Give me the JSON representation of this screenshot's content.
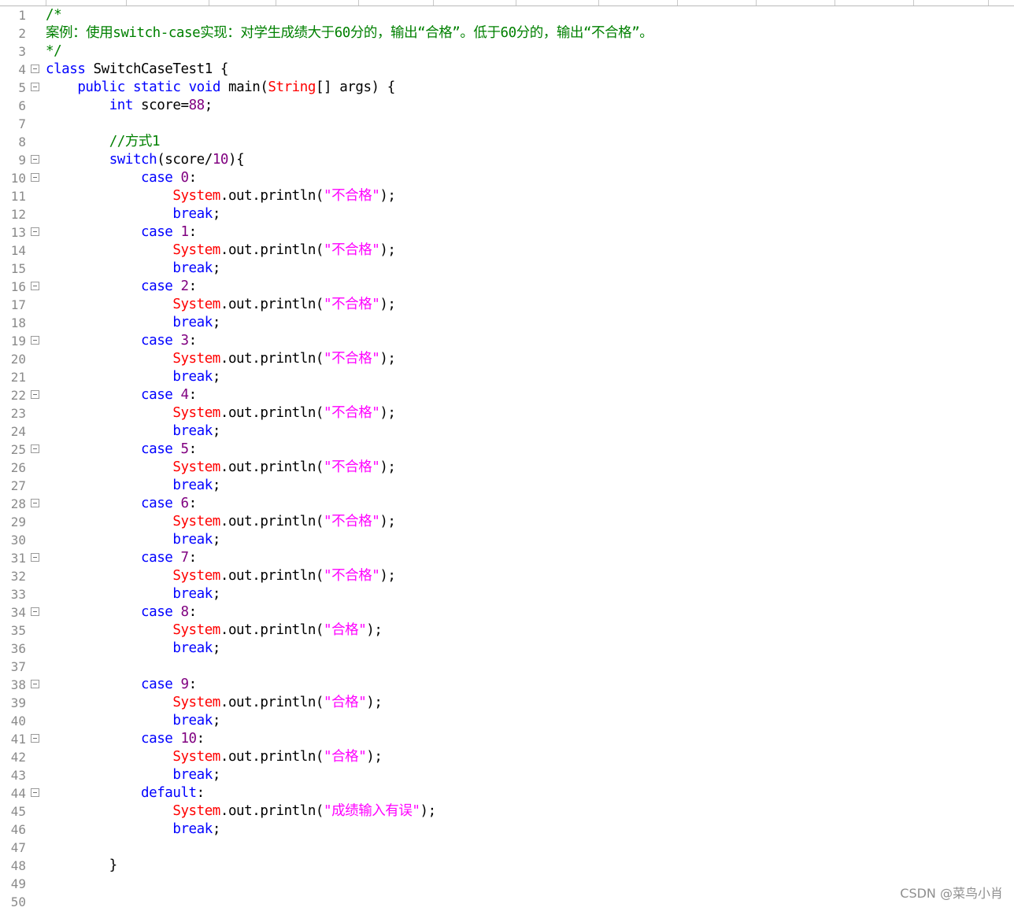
{
  "editor": {
    "lines": [
      {
        "n": "1",
        "fold": false,
        "tokens": [
          {
            "t": "/*",
            "c": "cmt"
          }
        ]
      },
      {
        "n": "2",
        "fold": false,
        "tokens": [
          {
            "t": "案例：使用switch-case实现：对学生成绩大于60分的，输出“合格”。低于60分的，输出“不合格”。",
            "c": "cmt"
          }
        ]
      },
      {
        "n": "3",
        "fold": false,
        "tokens": [
          {
            "t": "*/",
            "c": "cmt"
          }
        ]
      },
      {
        "n": "4",
        "fold": true,
        "tokens": [
          {
            "t": "class",
            "c": "kw"
          },
          {
            "t": " SwitchCaseTest1 {",
            "c": "plain"
          }
        ]
      },
      {
        "n": "5",
        "fold": true,
        "tokens": [
          {
            "t": "    ",
            "c": "plain"
          },
          {
            "t": "public",
            "c": "kw"
          },
          {
            "t": " ",
            "c": "plain"
          },
          {
            "t": "static",
            "c": "kw"
          },
          {
            "t": " ",
            "c": "plain"
          },
          {
            "t": "void",
            "c": "kw"
          },
          {
            "t": " main(",
            "c": "plain"
          },
          {
            "t": "String",
            "c": "type"
          },
          {
            "t": "[] args) {",
            "c": "plain"
          }
        ]
      },
      {
        "n": "6",
        "fold": false,
        "tokens": [
          {
            "t": "        ",
            "c": "plain"
          },
          {
            "t": "int",
            "c": "kw"
          },
          {
            "t": " score=",
            "c": "plain"
          },
          {
            "t": "88",
            "c": "num"
          },
          {
            "t": ";",
            "c": "plain"
          }
        ]
      },
      {
        "n": "7",
        "fold": false,
        "tokens": []
      },
      {
        "n": "8",
        "fold": false,
        "tokens": [
          {
            "t": "        ",
            "c": "plain"
          },
          {
            "t": "//方式1",
            "c": "cmt"
          }
        ]
      },
      {
        "n": "9",
        "fold": true,
        "tokens": [
          {
            "t": "        ",
            "c": "plain"
          },
          {
            "t": "switch",
            "c": "kw"
          },
          {
            "t": "(score/",
            "c": "plain"
          },
          {
            "t": "10",
            "c": "num"
          },
          {
            "t": "){",
            "c": "plain"
          }
        ]
      },
      {
        "n": "10",
        "fold": true,
        "tokens": [
          {
            "t": "            ",
            "c": "plain"
          },
          {
            "t": "case",
            "c": "kw"
          },
          {
            "t": " ",
            "c": "plain"
          },
          {
            "t": "0",
            "c": "num"
          },
          {
            "t": ":",
            "c": "plain"
          }
        ]
      },
      {
        "n": "11",
        "fold": false,
        "tokens": [
          {
            "t": "                ",
            "c": "plain"
          },
          {
            "t": "System",
            "c": "type"
          },
          {
            "t": ".out.println(",
            "c": "plain"
          },
          {
            "t": "\"不合格\"",
            "c": "str"
          },
          {
            "t": ");",
            "c": "plain"
          }
        ]
      },
      {
        "n": "12",
        "fold": false,
        "tokens": [
          {
            "t": "                ",
            "c": "plain"
          },
          {
            "t": "break",
            "c": "kw"
          },
          {
            "t": ";",
            "c": "plain"
          }
        ]
      },
      {
        "n": "13",
        "fold": true,
        "tokens": [
          {
            "t": "            ",
            "c": "plain"
          },
          {
            "t": "case",
            "c": "kw"
          },
          {
            "t": " ",
            "c": "plain"
          },
          {
            "t": "1",
            "c": "num"
          },
          {
            "t": ":",
            "c": "plain"
          }
        ]
      },
      {
        "n": "14",
        "fold": false,
        "tokens": [
          {
            "t": "                ",
            "c": "plain"
          },
          {
            "t": "System",
            "c": "type"
          },
          {
            "t": ".out.println(",
            "c": "plain"
          },
          {
            "t": "\"不合格\"",
            "c": "str"
          },
          {
            "t": ");",
            "c": "plain"
          }
        ]
      },
      {
        "n": "15",
        "fold": false,
        "tokens": [
          {
            "t": "                ",
            "c": "plain"
          },
          {
            "t": "break",
            "c": "kw"
          },
          {
            "t": ";",
            "c": "plain"
          }
        ]
      },
      {
        "n": "16",
        "fold": true,
        "tokens": [
          {
            "t": "            ",
            "c": "plain"
          },
          {
            "t": "case",
            "c": "kw"
          },
          {
            "t": " ",
            "c": "plain"
          },
          {
            "t": "2",
            "c": "num"
          },
          {
            "t": ":",
            "c": "plain"
          }
        ]
      },
      {
        "n": "17",
        "fold": false,
        "tokens": [
          {
            "t": "                ",
            "c": "plain"
          },
          {
            "t": "System",
            "c": "type"
          },
          {
            "t": ".out.println(",
            "c": "plain"
          },
          {
            "t": "\"不合格\"",
            "c": "str"
          },
          {
            "t": ");",
            "c": "plain"
          }
        ]
      },
      {
        "n": "18",
        "fold": false,
        "tokens": [
          {
            "t": "                ",
            "c": "plain"
          },
          {
            "t": "break",
            "c": "kw"
          },
          {
            "t": ";",
            "c": "plain"
          }
        ]
      },
      {
        "n": "19",
        "fold": true,
        "tokens": [
          {
            "t": "            ",
            "c": "plain"
          },
          {
            "t": "case",
            "c": "kw"
          },
          {
            "t": " ",
            "c": "plain"
          },
          {
            "t": "3",
            "c": "num"
          },
          {
            "t": ":",
            "c": "plain"
          }
        ]
      },
      {
        "n": "20",
        "fold": false,
        "tokens": [
          {
            "t": "                ",
            "c": "plain"
          },
          {
            "t": "System",
            "c": "type"
          },
          {
            "t": ".out.println(",
            "c": "plain"
          },
          {
            "t": "\"不合格\"",
            "c": "str"
          },
          {
            "t": ");",
            "c": "plain"
          }
        ]
      },
      {
        "n": "21",
        "fold": false,
        "tokens": [
          {
            "t": "                ",
            "c": "plain"
          },
          {
            "t": "break",
            "c": "kw"
          },
          {
            "t": ";",
            "c": "plain"
          }
        ]
      },
      {
        "n": "22",
        "fold": true,
        "tokens": [
          {
            "t": "            ",
            "c": "plain"
          },
          {
            "t": "case",
            "c": "kw"
          },
          {
            "t": " ",
            "c": "plain"
          },
          {
            "t": "4",
            "c": "num"
          },
          {
            "t": ":",
            "c": "plain"
          }
        ]
      },
      {
        "n": "23",
        "fold": false,
        "tokens": [
          {
            "t": "                ",
            "c": "plain"
          },
          {
            "t": "System",
            "c": "type"
          },
          {
            "t": ".out.println(",
            "c": "plain"
          },
          {
            "t": "\"不合格\"",
            "c": "str"
          },
          {
            "t": ");",
            "c": "plain"
          }
        ]
      },
      {
        "n": "24",
        "fold": false,
        "tokens": [
          {
            "t": "                ",
            "c": "plain"
          },
          {
            "t": "break",
            "c": "kw"
          },
          {
            "t": ";",
            "c": "plain"
          }
        ]
      },
      {
        "n": "25",
        "fold": true,
        "tokens": [
          {
            "t": "            ",
            "c": "plain"
          },
          {
            "t": "case",
            "c": "kw"
          },
          {
            "t": " ",
            "c": "plain"
          },
          {
            "t": "5",
            "c": "num"
          },
          {
            "t": ":",
            "c": "plain"
          }
        ]
      },
      {
        "n": "26",
        "fold": false,
        "tokens": [
          {
            "t": "                ",
            "c": "plain"
          },
          {
            "t": "System",
            "c": "type"
          },
          {
            "t": ".out.println(",
            "c": "plain"
          },
          {
            "t": "\"不合格\"",
            "c": "str"
          },
          {
            "t": ");",
            "c": "plain"
          }
        ]
      },
      {
        "n": "27",
        "fold": false,
        "tokens": [
          {
            "t": "                ",
            "c": "plain"
          },
          {
            "t": "break",
            "c": "kw"
          },
          {
            "t": ";",
            "c": "plain"
          }
        ]
      },
      {
        "n": "28",
        "fold": true,
        "tokens": [
          {
            "t": "            ",
            "c": "plain"
          },
          {
            "t": "case",
            "c": "kw"
          },
          {
            "t": " ",
            "c": "plain"
          },
          {
            "t": "6",
            "c": "num"
          },
          {
            "t": ":",
            "c": "plain"
          }
        ]
      },
      {
        "n": "29",
        "fold": false,
        "tokens": [
          {
            "t": "                ",
            "c": "plain"
          },
          {
            "t": "System",
            "c": "type"
          },
          {
            "t": ".out.println(",
            "c": "plain"
          },
          {
            "t": "\"不合格\"",
            "c": "str"
          },
          {
            "t": ");",
            "c": "plain"
          }
        ]
      },
      {
        "n": "30",
        "fold": false,
        "tokens": [
          {
            "t": "                ",
            "c": "plain"
          },
          {
            "t": "break",
            "c": "kw"
          },
          {
            "t": ";",
            "c": "plain"
          }
        ]
      },
      {
        "n": "31",
        "fold": true,
        "tokens": [
          {
            "t": "            ",
            "c": "plain"
          },
          {
            "t": "case",
            "c": "kw"
          },
          {
            "t": " ",
            "c": "plain"
          },
          {
            "t": "7",
            "c": "num"
          },
          {
            "t": ":",
            "c": "plain"
          }
        ]
      },
      {
        "n": "32",
        "fold": false,
        "tokens": [
          {
            "t": "                ",
            "c": "plain"
          },
          {
            "t": "System",
            "c": "type"
          },
          {
            "t": ".out.println(",
            "c": "plain"
          },
          {
            "t": "\"不合格\"",
            "c": "str"
          },
          {
            "t": ");",
            "c": "plain"
          }
        ]
      },
      {
        "n": "33",
        "fold": false,
        "tokens": [
          {
            "t": "                ",
            "c": "plain"
          },
          {
            "t": "break",
            "c": "kw"
          },
          {
            "t": ";",
            "c": "plain"
          }
        ]
      },
      {
        "n": "34",
        "fold": true,
        "tokens": [
          {
            "t": "            ",
            "c": "plain"
          },
          {
            "t": "case",
            "c": "kw"
          },
          {
            "t": " ",
            "c": "plain"
          },
          {
            "t": "8",
            "c": "num"
          },
          {
            "t": ":",
            "c": "plain"
          }
        ]
      },
      {
        "n": "35",
        "fold": false,
        "tokens": [
          {
            "t": "                ",
            "c": "plain"
          },
          {
            "t": "System",
            "c": "type"
          },
          {
            "t": ".out.println(",
            "c": "plain"
          },
          {
            "t": "\"合格\"",
            "c": "str"
          },
          {
            "t": ");",
            "c": "plain"
          }
        ]
      },
      {
        "n": "36",
        "fold": false,
        "tokens": [
          {
            "t": "                ",
            "c": "plain"
          },
          {
            "t": "break",
            "c": "kw"
          },
          {
            "t": ";",
            "c": "plain"
          }
        ]
      },
      {
        "n": "37",
        "fold": false,
        "tokens": []
      },
      {
        "n": "38",
        "fold": true,
        "tokens": [
          {
            "t": "            ",
            "c": "plain"
          },
          {
            "t": "case",
            "c": "kw"
          },
          {
            "t": " ",
            "c": "plain"
          },
          {
            "t": "9",
            "c": "num"
          },
          {
            "t": ":",
            "c": "plain"
          }
        ]
      },
      {
        "n": "39",
        "fold": false,
        "tokens": [
          {
            "t": "                ",
            "c": "plain"
          },
          {
            "t": "System",
            "c": "type"
          },
          {
            "t": ".out.println(",
            "c": "plain"
          },
          {
            "t": "\"合格\"",
            "c": "str"
          },
          {
            "t": ");",
            "c": "plain"
          }
        ]
      },
      {
        "n": "40",
        "fold": false,
        "tokens": [
          {
            "t": "                ",
            "c": "plain"
          },
          {
            "t": "break",
            "c": "kw"
          },
          {
            "t": ";",
            "c": "plain"
          }
        ]
      },
      {
        "n": "41",
        "fold": true,
        "tokens": [
          {
            "t": "            ",
            "c": "plain"
          },
          {
            "t": "case",
            "c": "kw"
          },
          {
            "t": " ",
            "c": "plain"
          },
          {
            "t": "10",
            "c": "num"
          },
          {
            "t": ":",
            "c": "plain"
          }
        ]
      },
      {
        "n": "42",
        "fold": false,
        "tokens": [
          {
            "t": "                ",
            "c": "plain"
          },
          {
            "t": "System",
            "c": "type"
          },
          {
            "t": ".out.println(",
            "c": "plain"
          },
          {
            "t": "\"合格\"",
            "c": "str"
          },
          {
            "t": ");",
            "c": "plain"
          }
        ]
      },
      {
        "n": "43",
        "fold": false,
        "tokens": [
          {
            "t": "                ",
            "c": "plain"
          },
          {
            "t": "break",
            "c": "kw"
          },
          {
            "t": ";",
            "c": "plain"
          }
        ]
      },
      {
        "n": "44",
        "fold": true,
        "tokens": [
          {
            "t": "            ",
            "c": "plain"
          },
          {
            "t": "default",
            "c": "kw"
          },
          {
            "t": ":",
            "c": "plain"
          }
        ]
      },
      {
        "n": "45",
        "fold": false,
        "tokens": [
          {
            "t": "                ",
            "c": "plain"
          },
          {
            "t": "System",
            "c": "type"
          },
          {
            "t": ".out.println(",
            "c": "plain"
          },
          {
            "t": "\"成绩输入有误\"",
            "c": "str"
          },
          {
            "t": ");",
            "c": "plain"
          }
        ]
      },
      {
        "n": "46",
        "fold": false,
        "tokens": [
          {
            "t": "                ",
            "c": "plain"
          },
          {
            "t": "break",
            "c": "kw"
          },
          {
            "t": ";",
            "c": "plain"
          }
        ]
      },
      {
        "n": "47",
        "fold": false,
        "tokens": []
      },
      {
        "n": "48",
        "fold": false,
        "tokens": [
          {
            "t": "        }",
            "c": "plain"
          }
        ]
      },
      {
        "n": "49",
        "fold": false,
        "tokens": []
      },
      {
        "n": "50",
        "fold": false,
        "tokens": []
      }
    ]
  },
  "watermark": {
    "text": "CSDN @菜鸟小肖"
  },
  "colors": {
    "keyword": "#0000ff",
    "type": "#ff0000",
    "string": "#ff00ff",
    "number": "#800080",
    "comment": "#008000",
    "line_number": "#8a8a8a"
  }
}
